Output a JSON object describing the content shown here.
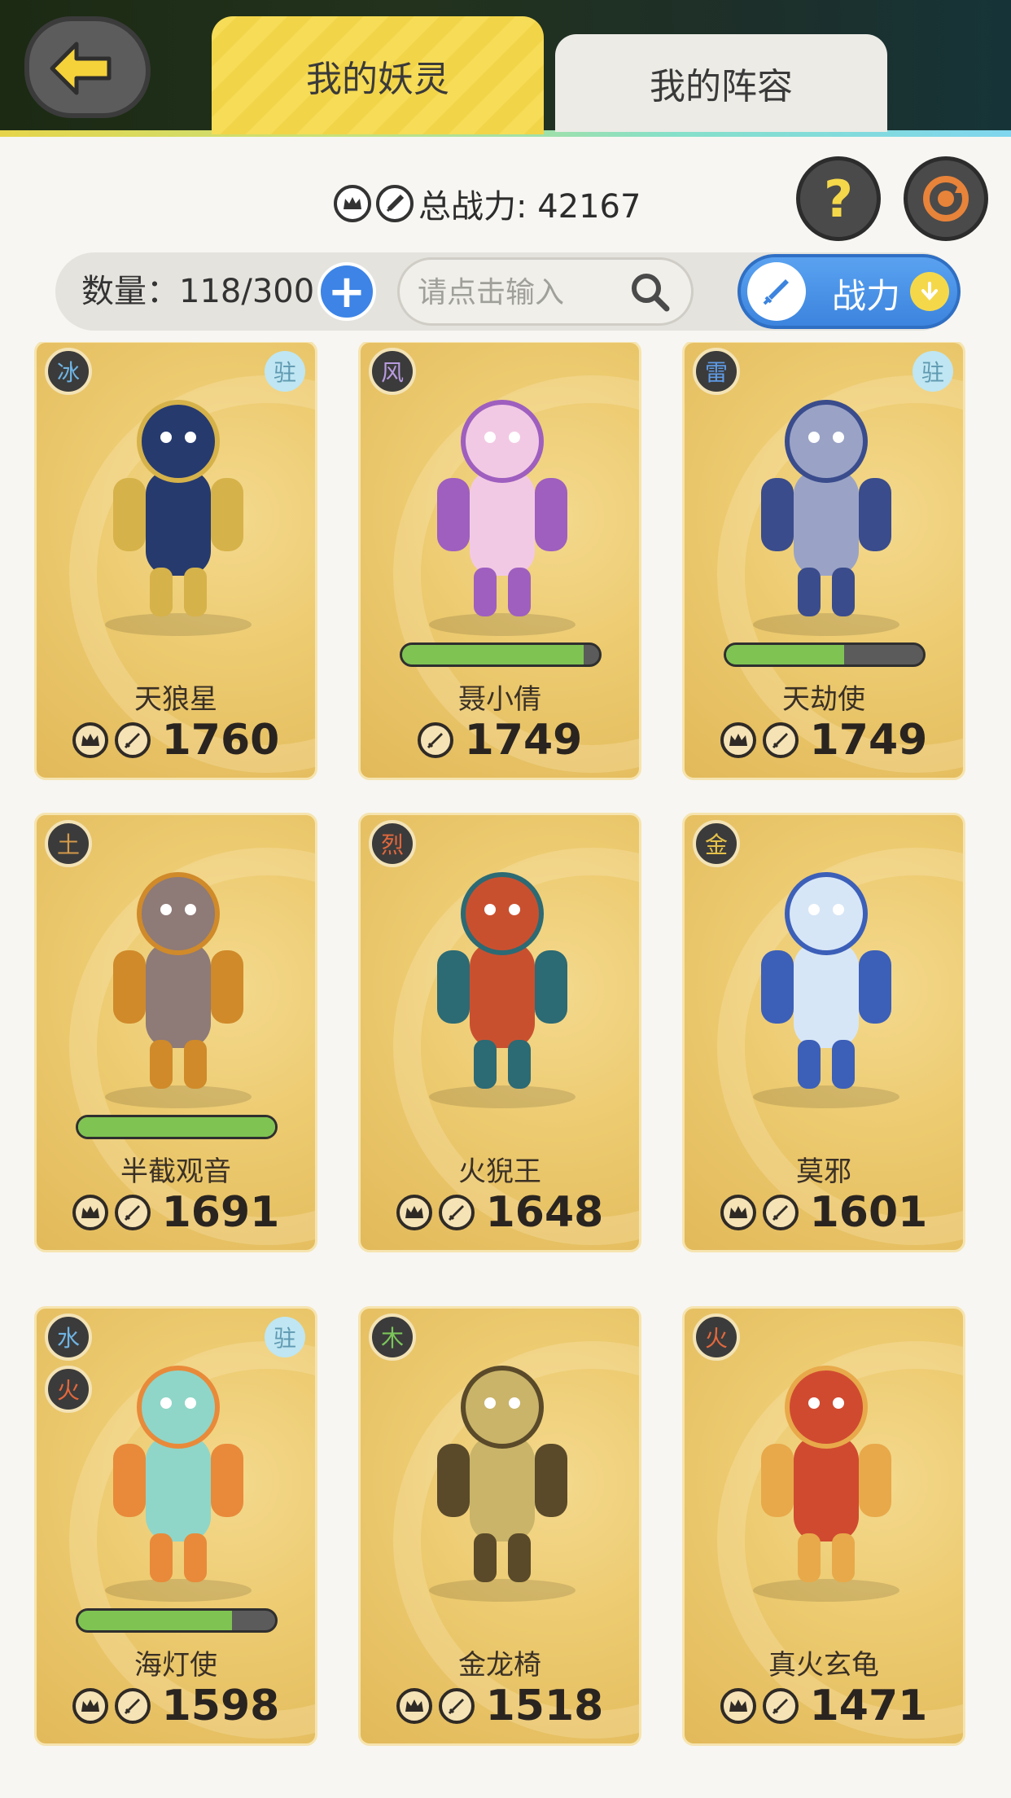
{
  "header": {
    "tabs": [
      {
        "label": "我的妖灵",
        "active": true
      },
      {
        "label": "我的阵容",
        "active": false
      }
    ]
  },
  "summary": {
    "power_label": "总战力: 42167",
    "count_label": "数量：118/300",
    "search_placeholder": "请点击输入",
    "sort_label": "战力",
    "help_symbol": "?"
  },
  "cards": [
    {
      "name": "天狼星",
      "power": "1760",
      "elements": [
        {
          "label": "冰",
          "color": "#6fb4e4"
        }
      ],
      "stationed": "驻",
      "progress": null,
      "crown": true,
      "figure": "blue-wolf-warrior",
      "body": "#263a6e",
      "accent": "#d6b24a"
    },
    {
      "name": "聂小倩",
      "power": "1749",
      "elements": [
        {
          "label": "风",
          "color": "#b99be0"
        }
      ],
      "stationed": null,
      "progress": 0.92,
      "crown": false,
      "figure": "pink-ghost-girl",
      "body": "#f2c9e4",
      "accent": "#9e5fbf"
    },
    {
      "name": "天劫使",
      "power": "1749",
      "elements": [
        {
          "label": "雷",
          "color": "#5f9be6"
        }
      ],
      "stationed": "驻",
      "progress": 0.6,
      "crown": true,
      "figure": "thunder-mech",
      "body": "#9aa3c6",
      "accent": "#3a4c8c"
    },
    {
      "name": "半截观音",
      "power": "1691",
      "elements": [
        {
          "label": "土",
          "color": "#d49a4a"
        }
      ],
      "stationed": null,
      "progress": 1.0,
      "crown": true,
      "figure": "rat-warrior",
      "body": "#8e7a77",
      "accent": "#d08a2a"
    },
    {
      "name": "火猊王",
      "power": "1648",
      "elements": [
        {
          "label": "烈",
          "color": "#e2683d"
        }
      ],
      "stationed": null,
      "progress": null,
      "crown": true,
      "figure": "fire-beast-king",
      "body": "#c9502f",
      "accent": "#2c6a74"
    },
    {
      "name": "莫邪",
      "power": "1601",
      "elements": [
        {
          "label": "金",
          "color": "#e6c24a"
        }
      ],
      "stationed": null,
      "progress": null,
      "crown": true,
      "figure": "sword-maiden",
      "body": "#d7e6f6",
      "accent": "#3c5fb8"
    },
    {
      "name": "海灯使",
      "power": "1598",
      "elements": [
        {
          "label": "水",
          "color": "#6fb4e4"
        },
        {
          "label": "火",
          "color": "#e2683d"
        }
      ],
      "stationed": "驻",
      "progress": 0.78,
      "crown": true,
      "figure": "lantern-fairy",
      "body": "#8fd6c8",
      "accent": "#e88a3a"
    },
    {
      "name": "金龙椅",
      "power": "1518",
      "elements": [
        {
          "label": "木",
          "color": "#7bc65a"
        }
      ],
      "stationed": null,
      "progress": null,
      "crown": true,
      "figure": "golden-dragon-throne",
      "body": "#c9b469",
      "accent": "#5a4a2a"
    },
    {
      "name": "真火玄龟",
      "power": "1471",
      "elements": [
        {
          "label": "火",
          "color": "#e2683d"
        }
      ],
      "stationed": null,
      "progress": null,
      "crown": true,
      "figure": "fire-turtle",
      "body": "#d04a30",
      "accent": "#e8a94a"
    }
  ]
}
